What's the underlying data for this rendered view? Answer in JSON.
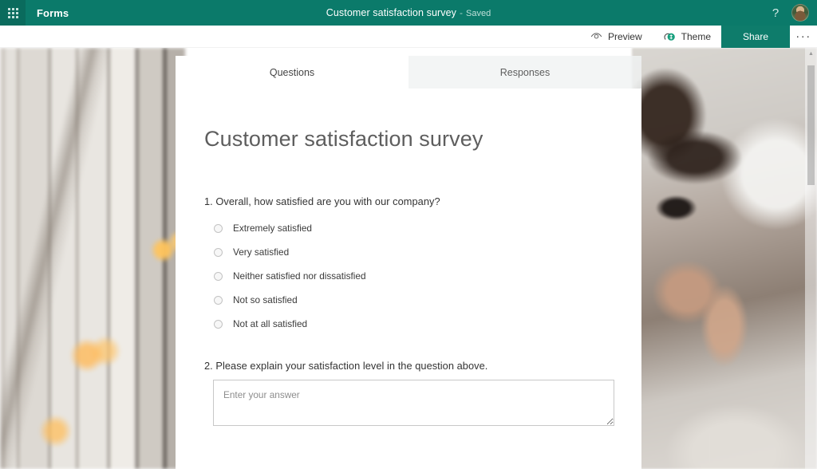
{
  "topbar": {
    "waffle_label": "app-launcher",
    "app_name": "Forms",
    "doc_title": "Customer satisfaction survey",
    "separator": "-",
    "saved_status": "Saved",
    "help_glyph": "?",
    "brand_color": "#0b7a6a"
  },
  "commandbar": {
    "preview_label": "Preview",
    "theme_label": "Theme",
    "share_label": "Share",
    "more_glyph": "···",
    "share_color": "#0e7c6b"
  },
  "tabs": [
    {
      "label": "Questions",
      "active": true
    },
    {
      "label": "Responses",
      "active": false
    }
  ],
  "form": {
    "title": "Customer satisfaction survey",
    "questions": [
      {
        "number": "1.",
        "text": "Overall, how satisfied are you with our company?",
        "type": "choice",
        "options": [
          "Extremely satisfied",
          "Very satisfied",
          "Neither satisfied nor dissatisfied",
          "Not so satisfied",
          "Not at all satisfied"
        ]
      },
      {
        "number": "2.",
        "text": "Please explain your satisfaction level in the question above.",
        "type": "text",
        "value": "",
        "placeholder": "Enter your answer"
      }
    ]
  },
  "scrollbar": {
    "up_arrow": "▲"
  }
}
